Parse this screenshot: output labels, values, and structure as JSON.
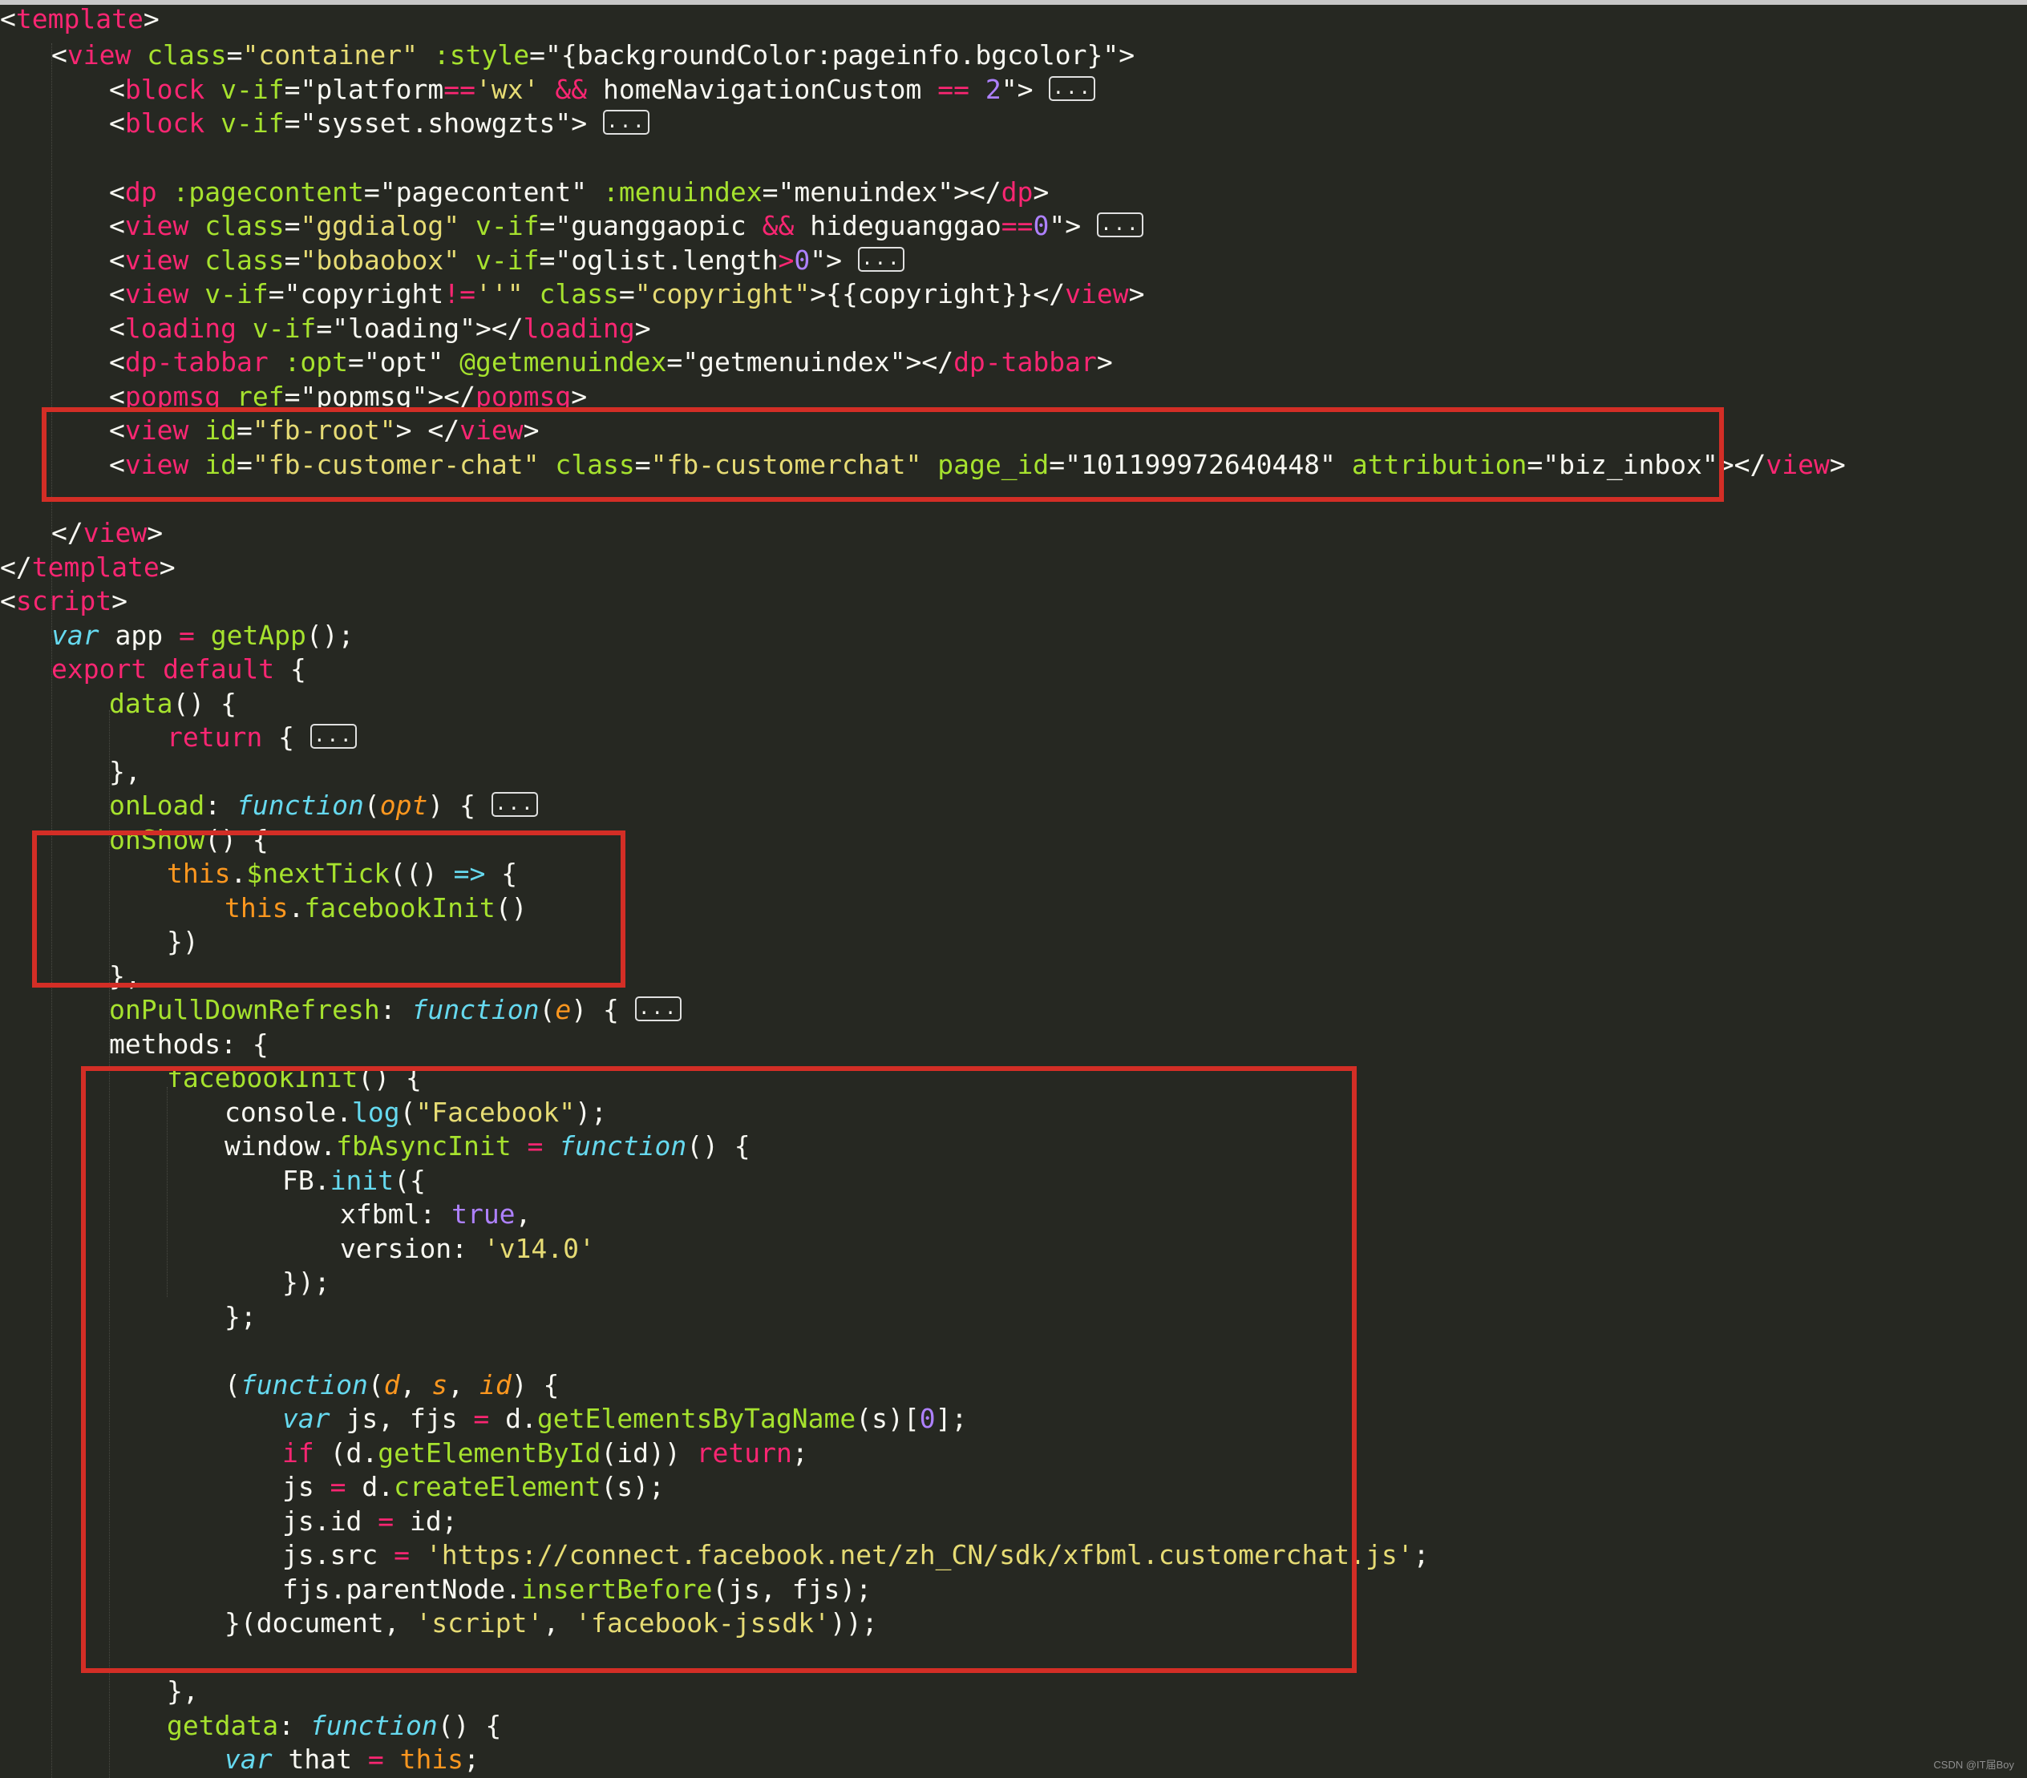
{
  "colors": {
    "background": "#262822",
    "tag": "#f92672",
    "attribute": "#a6e22e",
    "string": "#e6db74",
    "number": "#ae81ff",
    "function_keyword": "#66d9ef",
    "parameter": "#fd971f",
    "highlight_box": "#d32e26"
  },
  "fold_label": "...",
  "watermark": "CSDN @IT届Boy",
  "code": {
    "l1": {
      "a": "<",
      "b": "template",
      "c": ">"
    },
    "l2": {
      "a": "<",
      "b": "view",
      "c": " ",
      "d": "class",
      "e": "=",
      "f": "\"container\"",
      "g": " ",
      "h": ":style",
      "i": "=",
      "j": "\"{backgroundColor:pageinfo.bgcolor}\"",
      "k": ">"
    },
    "l3": {
      "a": "<",
      "b": "block",
      "c": " ",
      "d": "v-if",
      "e": "=",
      "f": "\"platform",
      "g": "==",
      "h": "'wx'",
      "i": " ",
      "j": "&&",
      "k": " homeNavigationCustom ",
      "l": "==",
      "m": " ",
      "n": "2",
      "o": "\"",
      "p": "> "
    },
    "l4": {
      "a": "<",
      "b": "block",
      "c": " ",
      "d": "v-if",
      "e": "=",
      "f": "\"sysset.showgzts\"",
      "g": "> "
    },
    "l6": {
      "a": "<",
      "b": "dp",
      "c": " ",
      "d": ":pagecontent",
      "e": "=",
      "f": "\"pagecontent\"",
      "g": " ",
      "h": ":menuindex",
      "i": "=",
      "j": "\"menuindex\"",
      "k": "></",
      "l": "dp",
      "m": ">"
    },
    "l7": {
      "a": "<",
      "b": "view",
      "c": " ",
      "d": "class",
      "e": "=",
      "f": "\"ggdialog\"",
      "g": " ",
      "h": "v-if",
      "i": "=",
      "j": "\"guanggaopic ",
      "k": "&&",
      "l": " hideguanggao",
      "m": "==",
      "n": "0",
      "o": "\"",
      "p": "> "
    },
    "l8": {
      "a": "<",
      "b": "view",
      "c": " ",
      "d": "class",
      "e": "=",
      "f": "\"bobaobox\"",
      "g": " ",
      "h": "v-if",
      "i": "=",
      "j": "\"oglist.length",
      "k": ">",
      "l": "0",
      "m": "\"",
      "n": "> "
    },
    "l9": {
      "a": "<",
      "b": "view",
      "c": " ",
      "d": "v-if",
      "e": "=",
      "f": "\"copyright",
      "g": "!=",
      "h": "''\"",
      "i": " ",
      "j": "class",
      "k": "=",
      "l": "\"copyright\"",
      "m": ">{{copyright}}</",
      "n": "view",
      "o": ">"
    },
    "l10": {
      "a": "<",
      "b": "loading",
      "c": " ",
      "d": "v-if",
      "e": "=",
      "f": "\"loading\"",
      "g": "></",
      "h": "loading",
      "i": ">"
    },
    "l11": {
      "a": "<",
      "b": "dp-tabbar",
      "c": " ",
      "d": ":opt",
      "e": "=",
      "f": "\"opt\"",
      "g": " ",
      "h": "@getmenuindex",
      "i": "=",
      "j": "\"getmenuindex\"",
      "k": "></",
      "l": "dp-tabbar",
      "m": ">"
    },
    "l12": {
      "a": "<",
      "b": "popmsg",
      "c": " ",
      "d": "ref",
      "e": "=",
      "f": "\"popmsg\"",
      "g": "></",
      "h": "popmsg",
      "i": ">"
    },
    "l13": {
      "a": "<",
      "b": "view",
      "c": " ",
      "d": "id",
      "e": "=",
      "f": "\"fb-root\"",
      "g": "> </",
      "h": "view",
      "i": ">"
    },
    "l14": {
      "a": "<",
      "b": "view",
      "c": " ",
      "d": "id",
      "e": "=",
      "f": "\"fb-customer-chat\"",
      "g": " ",
      "h": "class",
      "i": "=",
      "j": "\"fb-customerchat\"",
      "k": " ",
      "l": "page_id",
      "m": "=",
      "n": "\"101199972640448\"",
      "o": " ",
      "p": "attribution",
      "q": "=",
      "r": "\"biz_inbox\"",
      "s": "></",
      "t": "view",
      "u": ">"
    },
    "l16": {
      "a": "</",
      "b": "view",
      "c": ">"
    },
    "l17": {
      "a": "</",
      "b": "template",
      "c": ">"
    },
    "l18": {
      "a": "<",
      "b": "script",
      "c": ">"
    },
    "l19": {
      "a": "var",
      "b": " app ",
      "c": "=",
      "d": " ",
      "e": "getApp",
      "f": "();"
    },
    "l20": {
      "a": "export",
      "b": " ",
      "c": "default",
      "d": " {"
    },
    "l21": {
      "a": "data",
      "b": "() {"
    },
    "l22": {
      "a": "return",
      "b": " { "
    },
    "l23": {
      "a": "},"
    },
    "l24": {
      "a": "onLoad",
      "b": ": ",
      "c": "function",
      "d": "(",
      "e": "opt",
      "f": ") { "
    },
    "l25": {
      "a": "onShow",
      "b": "() {"
    },
    "l26": {
      "a": "this",
      "b": ".",
      "c": "$nextTick",
      "d": "(() ",
      "e": "=>",
      "f": " {"
    },
    "l27": {
      "a": "this",
      "b": ".",
      "c": "facebookInit",
      "d": "()"
    },
    "l28": {
      "a": "})"
    },
    "l29": {
      "a": "},"
    },
    "l30": {
      "a": "onPullDownRefresh",
      "b": ": ",
      "c": "function",
      "d": "(",
      "e": "e",
      "f": ") { "
    },
    "l31": {
      "a": "methods",
      "b": ": {"
    },
    "l32": {
      "a": "facebookInit",
      "b": "() {"
    },
    "l33": {
      "a": "console.",
      "b": "log",
      "c": "(",
      "d": "\"Facebook\"",
      "e": ");"
    },
    "l34": {
      "a": "window.",
      "b": "fbAsyncInit",
      "c": " ",
      "d": "=",
      "e": " ",
      "f": "function",
      "g": "() {"
    },
    "l35": {
      "a": "FB.",
      "b": "init",
      "c": "({"
    },
    "l36": {
      "a": "xfbml: ",
      "b": "true",
      "c": ","
    },
    "l37": {
      "a": "version: ",
      "b": "'v14.0'"
    },
    "l38": {
      "a": "});"
    },
    "l39": {
      "a": "};"
    },
    "l41": {
      "a": "(",
      "b": "function",
      "c": "(",
      "d": "d",
      "e": ", ",
      "f": "s",
      "g": ", ",
      "h": "id",
      "i": ") {"
    },
    "l42": {
      "a": "var",
      "b": " js, fjs ",
      "c": "=",
      "d": " d.",
      "e": "getElementsByTagName",
      "f": "(s)[",
      "g": "0",
      "h": "];"
    },
    "l43": {
      "a": "if",
      "b": " (d.",
      "c": "getElementById",
      "d": "(id)) ",
      "e": "return",
      "f": ";"
    },
    "l44": {
      "a": "js ",
      "b": "=",
      "c": " d.",
      "d": "createElement",
      "e": "(s);"
    },
    "l45": {
      "a": "js.id ",
      "b": "=",
      "c": " id;"
    },
    "l46": {
      "a": "js.src ",
      "b": "=",
      "c": " ",
      "d": "'https://connect.facebook.net/zh_CN/sdk/xfbml.customerchat.js'",
      "e": ";"
    },
    "l47": {
      "a": "fjs.parentNode.",
      "b": "insertBefore",
      "c": "(js, fjs);"
    },
    "l48": {
      "a": "}(document, ",
      "b": "'script'",
      "c": ", ",
      "d": "'facebook-jssdk'",
      "e": "));"
    },
    "l50": {
      "a": "},"
    },
    "l51": {
      "a": "getdata",
      "b": ": ",
      "c": "function",
      "d": "() {"
    },
    "l52": {
      "a": "var",
      "b": " that ",
      "c": "=",
      "d": " ",
      "e": "this",
      "f": ";"
    }
  }
}
